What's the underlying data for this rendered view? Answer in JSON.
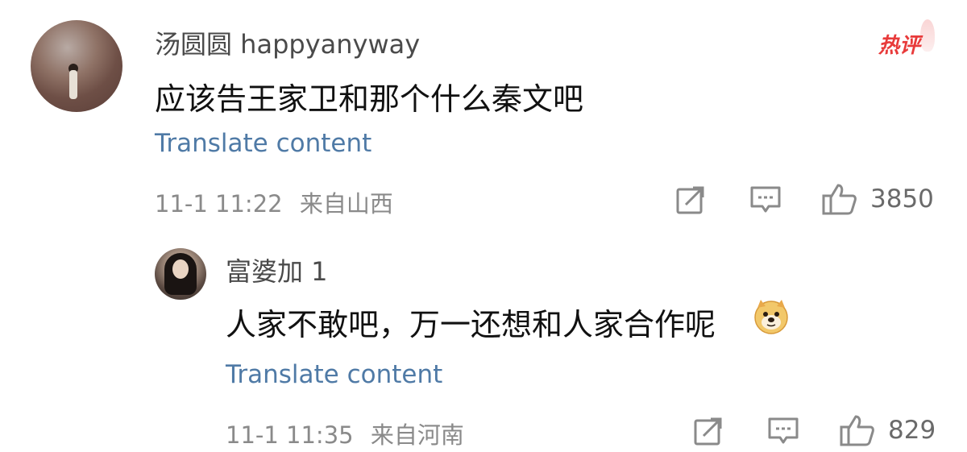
{
  "comment": {
    "username": "汤圆圆 happyanyway",
    "badge": "热评",
    "text": "应该告王家卫和那个什么秦文吧",
    "translate_label": "Translate content",
    "timestamp": "11-1 11:22",
    "location": "来自山西",
    "like_count": "3850",
    "icons": [
      "share-icon",
      "reply-icon",
      "like-icon"
    ]
  },
  "reply": {
    "username": "富婆加 1",
    "text": "人家不敢吧，万一还想和人家合作呢",
    "emoji": "doge-emoji",
    "translate_label": "Translate content",
    "timestamp": "11-1 11:35",
    "location": "来自河南",
    "like_count": "829",
    "icons": [
      "share-icon",
      "reply-icon",
      "like-icon"
    ]
  },
  "colors": {
    "link": "#4f7aa6",
    "badge": "#e83a3a",
    "meta": "#8a8a8a",
    "text": "#111111"
  }
}
